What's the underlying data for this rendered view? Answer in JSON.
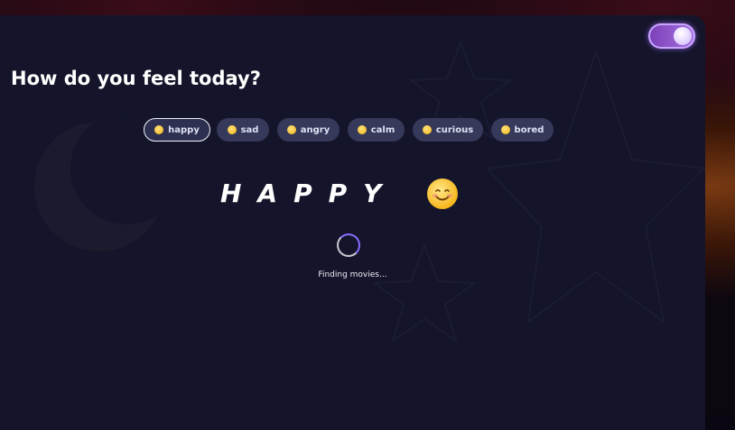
{
  "title": "How do you feel today?",
  "moods": [
    {
      "label": "happy",
      "icon": "smiling-face-icon",
      "active": true
    },
    {
      "label": "sad",
      "icon": "sad-face-icon",
      "active": false
    },
    {
      "label": "angry",
      "icon": "angry-face-icon",
      "active": false
    },
    {
      "label": "calm",
      "icon": "calm-face-icon",
      "active": false
    },
    {
      "label": "curious",
      "icon": "curious-face-icon",
      "active": false
    },
    {
      "label": "bored",
      "icon": "bored-face-icon",
      "active": false
    }
  ],
  "selected": {
    "word": "HAPPY",
    "icon": "smiling-face-icon"
  },
  "status_text": "Finding movies...",
  "theme_toggle": {
    "state": "on",
    "icon": "moon-toggle-icon"
  },
  "colors": {
    "panel": "#14152a",
    "chip": "#36395a",
    "accent": "#8a6bff",
    "toggle": "#7b3fb8"
  }
}
